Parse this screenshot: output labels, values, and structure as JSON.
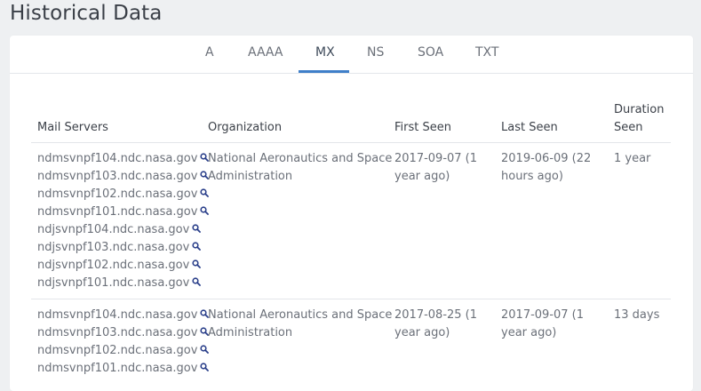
{
  "page": {
    "title": "Historical Data"
  },
  "tabs": [
    "A",
    "AAAA",
    "MX",
    "NS",
    "SOA",
    "TXT"
  ],
  "active_tab": "MX",
  "table": {
    "headers": {
      "mail_servers": "Mail Servers",
      "organization": "Organization",
      "first_seen": "First Seen",
      "last_seen": "Last Seen",
      "duration_seen_line1": "Duration",
      "duration_seen_line2": "Seen"
    },
    "rows": [
      {
        "servers": [
          "ndmsvnpf104.ndc.nasa.gov",
          "ndmsvnpf103.ndc.nasa.gov",
          "ndmsvnpf102.ndc.nasa.gov",
          "ndmsvnpf101.ndc.nasa.gov",
          "ndjsvnpf104.ndc.nasa.gov",
          "ndjsvnpf103.ndc.nasa.gov",
          "ndjsvnpf102.ndc.nasa.gov",
          "ndjsvnpf101.ndc.nasa.gov"
        ],
        "organization_line1": "National Aeronautics and Space",
        "organization_line2": "Administration",
        "first_seen_line1": "2017-09-07 (1",
        "first_seen_line2": "year ago)",
        "last_seen_line1": "2019-06-09 (22",
        "last_seen_line2": "hours ago)",
        "duration": "1 year"
      },
      {
        "servers": [
          "ndmsvnpf104.ndc.nasa.gov",
          "ndmsvnpf103.ndc.nasa.gov",
          "ndmsvnpf102.ndc.nasa.gov",
          "ndmsvnpf101.ndc.nasa.gov"
        ],
        "organization_line1": "National Aeronautics and Space",
        "organization_line2": "Administration",
        "first_seen_line1": "2017-08-25 (1",
        "first_seen_line2": "year ago)",
        "last_seen_line1": "2017-09-07 (1",
        "last_seen_line2": "year ago)",
        "duration": "13 days"
      }
    ]
  },
  "icons": {
    "search": "search-icon"
  },
  "colors": {
    "accent": "#3f7fc9",
    "icon": "#2a3f8a",
    "background": "#eef0f2"
  }
}
